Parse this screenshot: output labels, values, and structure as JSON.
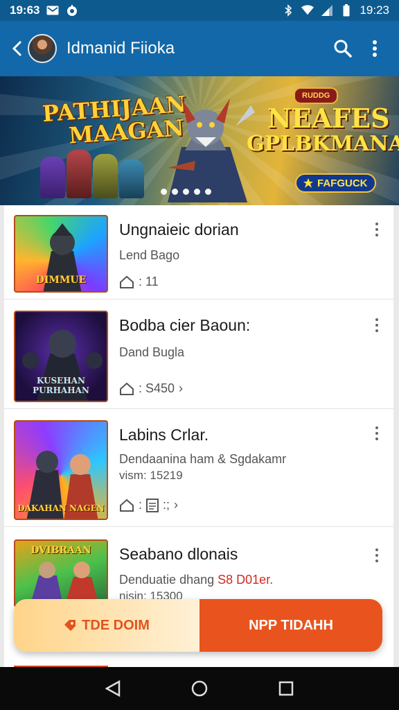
{
  "status": {
    "time_left": "19:63",
    "time_right": "19:23"
  },
  "app_bar": {
    "title": "Idmanid Fiioka"
  },
  "banner": {
    "left_title_1": "PATHIJAAN",
    "left_title_2": "MAAGAN",
    "right_title_1": "NEAFES",
    "right_title_2": "GPLBKMANAI",
    "badge": "RUDDG",
    "cta_label": "FAFGUCK",
    "slide_count": 5
  },
  "items": [
    {
      "title": "Ungnaieic dorian",
      "subtitle": "Lend Bago",
      "meta": ": 11",
      "thumb_label": "DIMMUE"
    },
    {
      "title": "Bodba cier Baoun:",
      "subtitle": "Dand Bugla",
      "meta": ": S450",
      "thumb_label": "KUSEHAN PURHAHAN"
    },
    {
      "title": "Labins Crlar.",
      "subtitle": "Dendaanina ham & Sgdakamr",
      "subtitle2": "vism: 15219",
      "meta": ":;",
      "thumb_label": "DAKAHAN NAGEN"
    },
    {
      "title": "Seabano dlonais",
      "subtitle": "Denduatie dhang",
      "price": "S8 D01er.",
      "subtitle2": "nisin: 15300",
      "thumb_label": "DVIBRAAN"
    }
  ],
  "actions": {
    "left_label": "TDE DOIM",
    "right_label": "NPP TIDAHH"
  },
  "colors": {
    "primary": "#1268a8",
    "accent": "#e9541e",
    "price": "#d2291d"
  }
}
